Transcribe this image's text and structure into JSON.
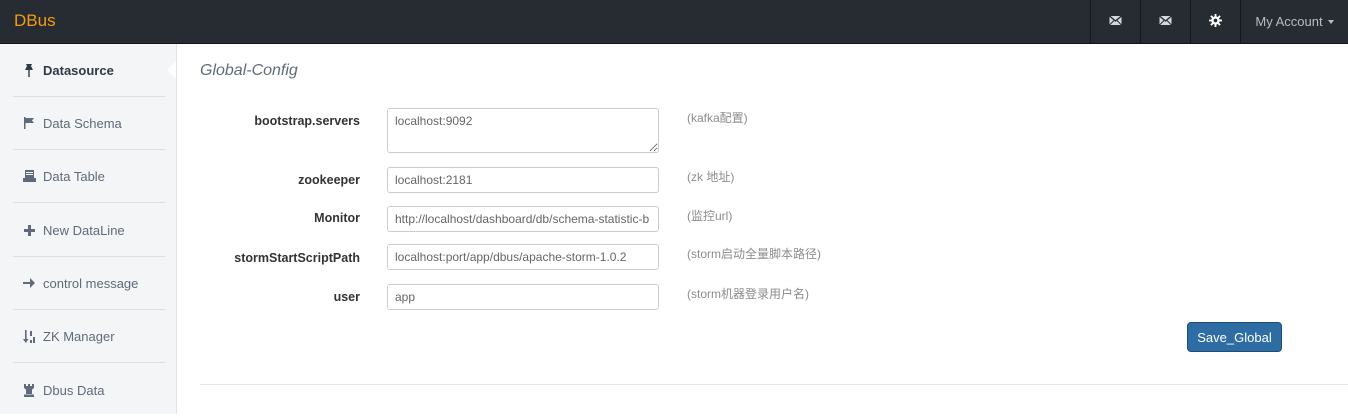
{
  "navbar": {
    "brand": "DBus",
    "icons": [
      "envelope-icon",
      "envelope-icon",
      "gear-icon"
    ],
    "account_label": "My Account",
    "colors": {
      "background": "#272c33",
      "brand": "#f39c12"
    }
  },
  "sidebar": {
    "items": [
      {
        "label": "Datasource",
        "icon": "pushpin-icon",
        "active": true
      },
      {
        "label": "Data Schema",
        "icon": "flag-icon",
        "active": false
      },
      {
        "label": "Data Table",
        "icon": "tray-icon",
        "active": false
      },
      {
        "label": "New DataLine",
        "icon": "plus-icon",
        "active": false
      },
      {
        "label": "control message",
        "icon": "arrow-right-icon",
        "active": false
      },
      {
        "label": "ZK Manager",
        "icon": "sort-order-icon",
        "active": false
      },
      {
        "label": "Dbus Data",
        "icon": "tower-icon",
        "active": false
      }
    ]
  },
  "main": {
    "title": "Global-Config",
    "fields": [
      {
        "label": "bootstrap.servers",
        "value": "localhost:9092",
        "hint": "(kafka配置)"
      },
      {
        "label": "zookeeper",
        "value": "localhost:2181",
        "hint": "(zk 地址)"
      },
      {
        "label": "Monitor",
        "value": "http://localhost/dashboard/db/schema-statistic-b",
        "hint": "(监控url)"
      },
      {
        "label": "stormStartScriptPath",
        "value": "localhost:port/app/dbus/apache-storm-1.0.2",
        "hint": "(storm启动全量脚本路径)"
      },
      {
        "label": "user",
        "value": "app",
        "hint": "(storm机器登录用户名)"
      }
    ],
    "save_label": "Save_Global",
    "colors": {
      "primary_button": "#2e6da4"
    }
  }
}
